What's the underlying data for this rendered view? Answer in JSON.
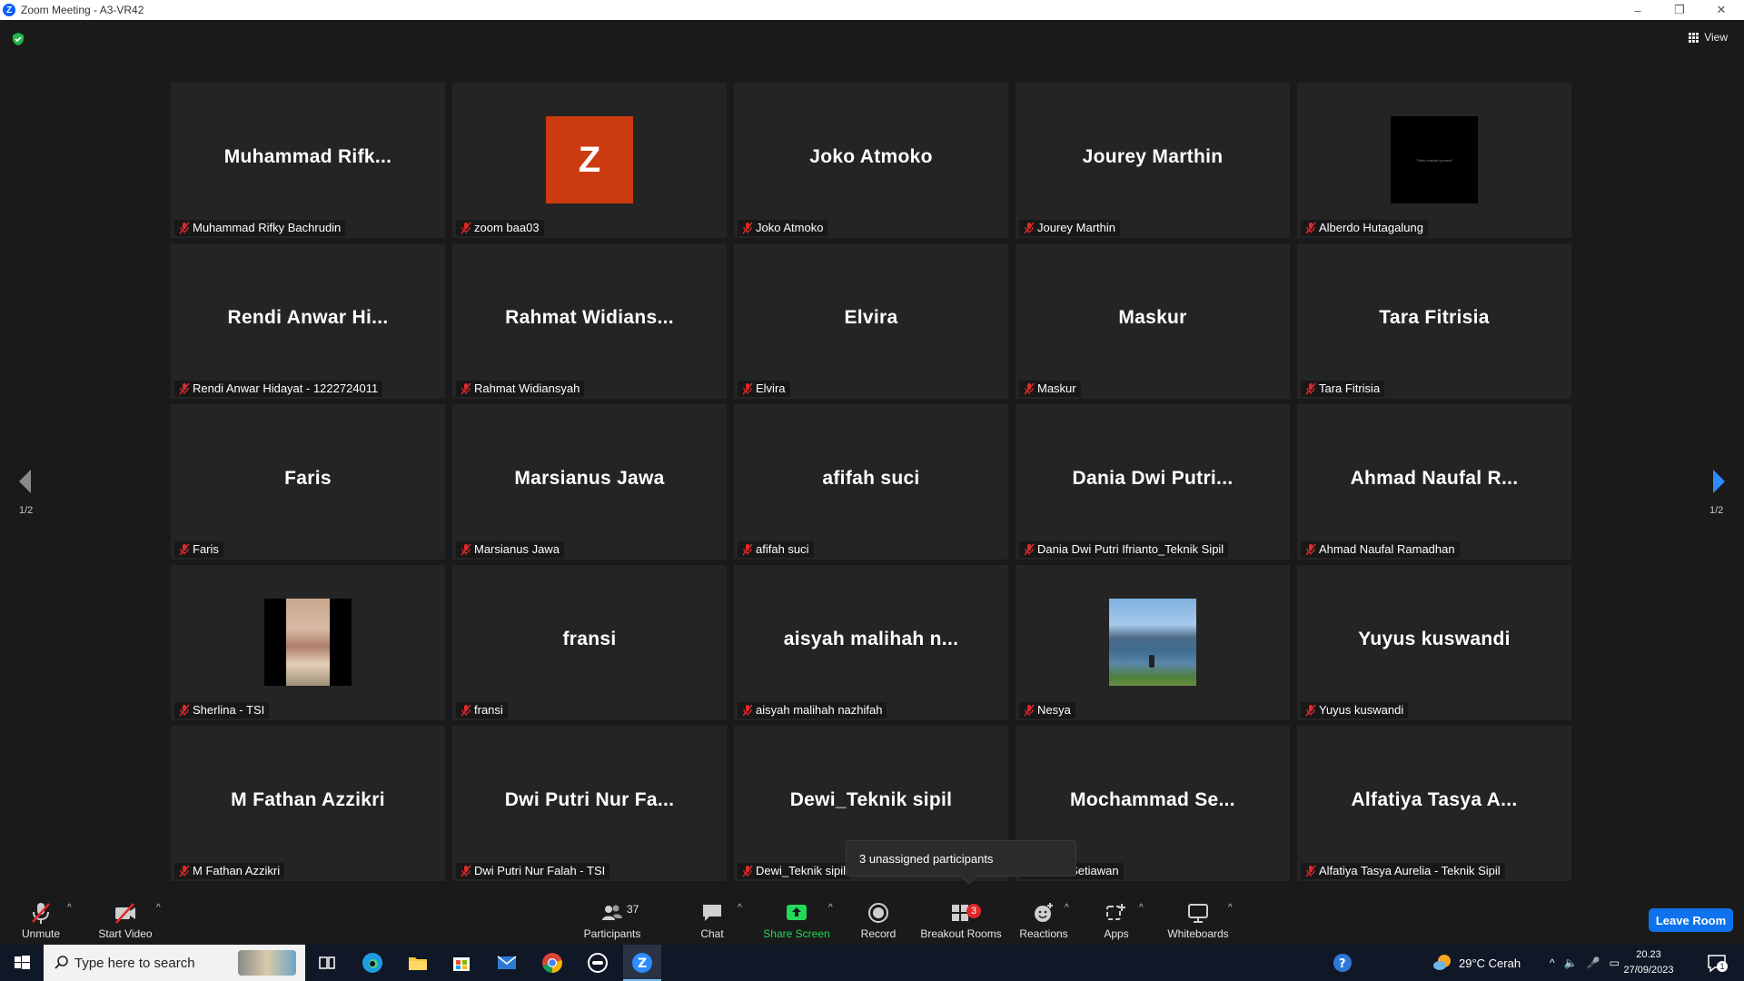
{
  "window": {
    "title": "Zoom Meeting - A3-VR42",
    "min": "–",
    "max": "❐",
    "close": "✕"
  },
  "top": {
    "view_label": "View"
  },
  "tiles": [
    {
      "big": "Muhammad  Rifk...",
      "label": "Muhammad Rifky Bachrudin"
    },
    {
      "big": "Z",
      "label": "zoom baa03"
    },
    {
      "big": "Joko Atmoko",
      "label": "Joko Atmoko"
    },
    {
      "big": "Jourey Marthin",
      "label": "Jourey Marthin"
    },
    {
      "big": "",
      "label": "Alberdo Hutagalung",
      "photo_text": "Think outside yourself"
    },
    {
      "big": "Rendi  Anwar  Hi...",
      "label": "Rendi Anwar Hidayat - 1222724011"
    },
    {
      "big": "Rahmat  Widians...",
      "label": "Rahmat Widiansyah"
    },
    {
      "big": "Elvira",
      "label": "Elvira"
    },
    {
      "big": "Maskur",
      "label": "Maskur"
    },
    {
      "big": "Tara Fitrisia",
      "label": "Tara Fitrisia"
    },
    {
      "big": "Faris",
      "label": "Faris"
    },
    {
      "big": "Marsianus Jawa",
      "label": "Marsianus Jawa"
    },
    {
      "big": "afifah suci",
      "label": "afifah suci"
    },
    {
      "big": "Dania  Dwi  Putri...",
      "label": "Dania Dwi Putri Ifrianto_Teknik Sipil"
    },
    {
      "big": "Ahmad  Naufal  R...",
      "label": "Ahmad Naufal Ramadhan"
    },
    {
      "big": "",
      "label": "Sherlina - TSI"
    },
    {
      "big": "fransi",
      "label": "fransi"
    },
    {
      "big": "aisyah  malihah  n...",
      "label": "aisyah malihah nazhifah"
    },
    {
      "big": "",
      "label": "Nesya"
    },
    {
      "big": "Yuyus kuswandi",
      "label": "Yuyus kuswandi"
    },
    {
      "big": "M Fathan Azzikri",
      "label": "M Fathan Azzikri"
    },
    {
      "big": "Dwi Putri Nur Fa...",
      "label": "Dwi Putri Nur Falah - TSI"
    },
    {
      "big": "Dewi_Teknik sipil",
      "label": "Dewi_Teknik sipil"
    },
    {
      "big": "Mochammad  Se...",
      "label": "nmad Setiawan"
    },
    {
      "big": "Alfatiya Tasya A...",
      "label": "Alfatiya Tasya Aurelia - Teknik Sipil"
    }
  ],
  "paging": {
    "left": "1/2",
    "right": "1/2"
  },
  "tooltip": "3 unassigned participants",
  "toolbar": {
    "unmute": "Unmute",
    "start_video": "Start Video",
    "participants": "Participants",
    "participants_count": "37",
    "chat": "Chat",
    "share_screen": "Share Screen",
    "record": "Record",
    "breakout_rooms": "Breakout Rooms",
    "breakout_badge": "3",
    "reactions": "Reactions",
    "apps": "Apps",
    "whiteboards": "Whiteboards",
    "leave": "Leave Room"
  },
  "taskbar": {
    "search_placeholder": "Type here to search",
    "weather": "29°C  Cerah",
    "time": "20.23",
    "date": "27/09/2023",
    "notif_count": "1"
  },
  "colors": {
    "accent_blue": "#0e72ed",
    "share_green": "#23d959",
    "muted_red": "#e02828",
    "avatar_orange": "#cc3b10"
  }
}
